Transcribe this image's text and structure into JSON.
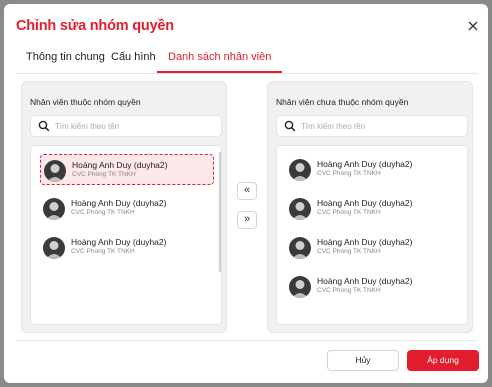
{
  "dialog": {
    "title": "Chỉnh sửa nhóm quyền"
  },
  "tabs": [
    {
      "label": "Thông tin chung"
    },
    {
      "label": "Cấu hình"
    },
    {
      "label": "Danh sách nhân viên"
    }
  ],
  "left_panel": {
    "title": "Nhân viên thuộc nhóm quyền",
    "search_placeholder": "Tìm kiếm theo tên",
    "items": [
      {
        "name": "Hoàng Anh Duy (duyha2)",
        "subtitle": "CVC Phòng TK TNKH",
        "selected": true
      },
      {
        "name": "Hoàng Anh Duy (duyha2)",
        "subtitle": "CVC Phòng TK TNKH",
        "selected": false
      },
      {
        "name": "Hoàng Anh Duy (duyha2)",
        "subtitle": "CVC Phòng TK TNKH",
        "selected": false
      }
    ]
  },
  "right_panel": {
    "title": "Nhân viên chưa thuộc nhóm quyền",
    "search_placeholder": "Tìm kiếm theo tên",
    "items": [
      {
        "name": "Hoàng Anh Duy (duyha2)",
        "subtitle": "CVC Phòng TK TNKH"
      },
      {
        "name": "Hoàng Anh Duy (duyha2)",
        "subtitle": "CVC Phòng TK TNKH"
      },
      {
        "name": "Hoàng Anh Duy (duyha2)",
        "subtitle": "CVC Phòng TK TNKH"
      },
      {
        "name": "Hoàng Anh Duy (duyha2)",
        "subtitle": "CVC Phòng TK TNKH"
      }
    ]
  },
  "transfer": {
    "move_left_label": "«",
    "move_right_label": "»"
  },
  "footer": {
    "cancel_label": "Hủy",
    "apply_label": "Áp dụng"
  },
  "colors": {
    "accent": "#e11d2e",
    "overlay": "#8a8a8a",
    "selected_bg": "#fde8ea"
  },
  "icons": {
    "close": "close-icon",
    "search": "search-icon",
    "avatar": "avatar"
  },
  "active_tab": 2
}
